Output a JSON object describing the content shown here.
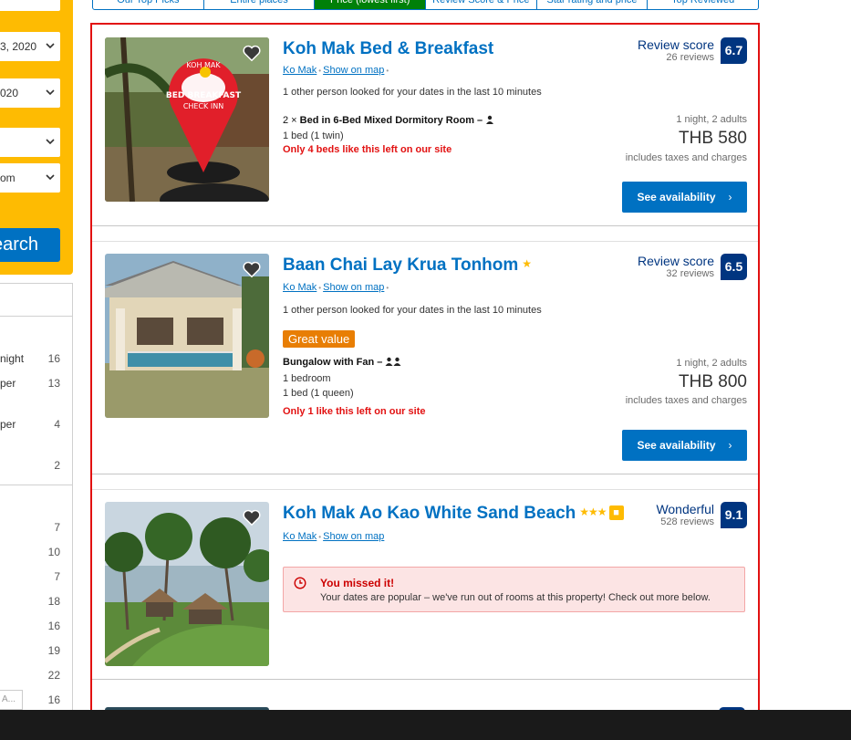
{
  "sidebar": {
    "date_checkin": "3, 2020",
    "date_checkout": "020",
    "search_label": "earch",
    "filter_items": [
      {
        "label": "night",
        "count": "16"
      },
      {
        "label": "per",
        "count": "13"
      },
      {
        "label": "per",
        "count": "4"
      },
      {
        "label": "",
        "count": "2"
      },
      {
        "label": "",
        "count": "7"
      },
      {
        "label": "",
        "count": "10"
      },
      {
        "label": "",
        "count": "7"
      },
      {
        "label": "",
        "count": "18"
      },
      {
        "label": "",
        "count": "16"
      },
      {
        "label": "",
        "count": "19"
      },
      {
        "label": "",
        "count": "22"
      },
      {
        "label": "",
        "count": "16"
      }
    ],
    "rooms_value": "om",
    "input_placeholder": "A..."
  },
  "tabs": [
    {
      "label": "Our Top Picks",
      "active": false
    },
    {
      "label": "Entire places",
      "active": false
    },
    {
      "label": "Price (lowest first)",
      "active": true
    },
    {
      "label": "Review Score & Price",
      "active": false
    },
    {
      "label": "Star rating and price",
      "active": false
    },
    {
      "label": "Top Reviewed",
      "active": false
    }
  ],
  "properties": [
    {
      "name": "Koh Mak Bed & Breakfast",
      "stars": "",
      "location": "Ko Mak",
      "map_link": "Show on map",
      "looked": "1 other person looked for your dates in the last 10 minutes",
      "room_qty": "2 ×",
      "room_name": "Bed in 6-Bed Mixed Dormitory Room",
      "room_suffix": "–",
      "beds": [
        "1 bed (1 twin)"
      ],
      "scarcity": "Only 4 beds like this left on our site",
      "score_label": "Review score",
      "reviews": "26 reviews",
      "score": "6.7",
      "price_meta": "1 night, 2 adults",
      "price": "THB 580",
      "price_note": "includes taxes and charges",
      "button": "See availability"
    },
    {
      "name": "Baan Chai Lay Krua Tonhom",
      "stars": "★",
      "location": "Ko Mak",
      "map_link": "Show on map",
      "looked": "1 other person looked for your dates in the last 10 minutes",
      "badge": "Great value",
      "room_name": "Bungalow with Fan",
      "room_suffix": "–",
      "beds": [
        "1 bedroom",
        "1 bed (1 queen)"
      ],
      "scarcity": "Only 1 like this left on our site",
      "score_label": "Review score",
      "reviews": "32 reviews",
      "score": "6.5",
      "price_meta": "1 night, 2 adults",
      "price": "THB 800",
      "price_note": "includes taxes and charges",
      "button": "See availability"
    },
    {
      "name": "Koh Mak Ao Kao White Sand Beach",
      "stars": "★★★",
      "location": "Ko Mak",
      "map_link": "Show on map",
      "score_label": "Wonderful",
      "reviews": "528 reviews",
      "score": "9.1",
      "missed_title": "You missed it!",
      "missed_text": "Your dates are popular – we've run out of rooms at this property! Check out more below."
    }
  ],
  "photo_text": {
    "sign_top": "KOH MAK",
    "sign_mid": "BED BREAKFAST",
    "sign_bottom": "CHECK INN"
  },
  "colors": {
    "brand_blue": "#0071c2",
    "dark_blue": "#003580",
    "yellow": "#febb02",
    "active_tab": "#008009",
    "alert_red": "#e21111"
  }
}
